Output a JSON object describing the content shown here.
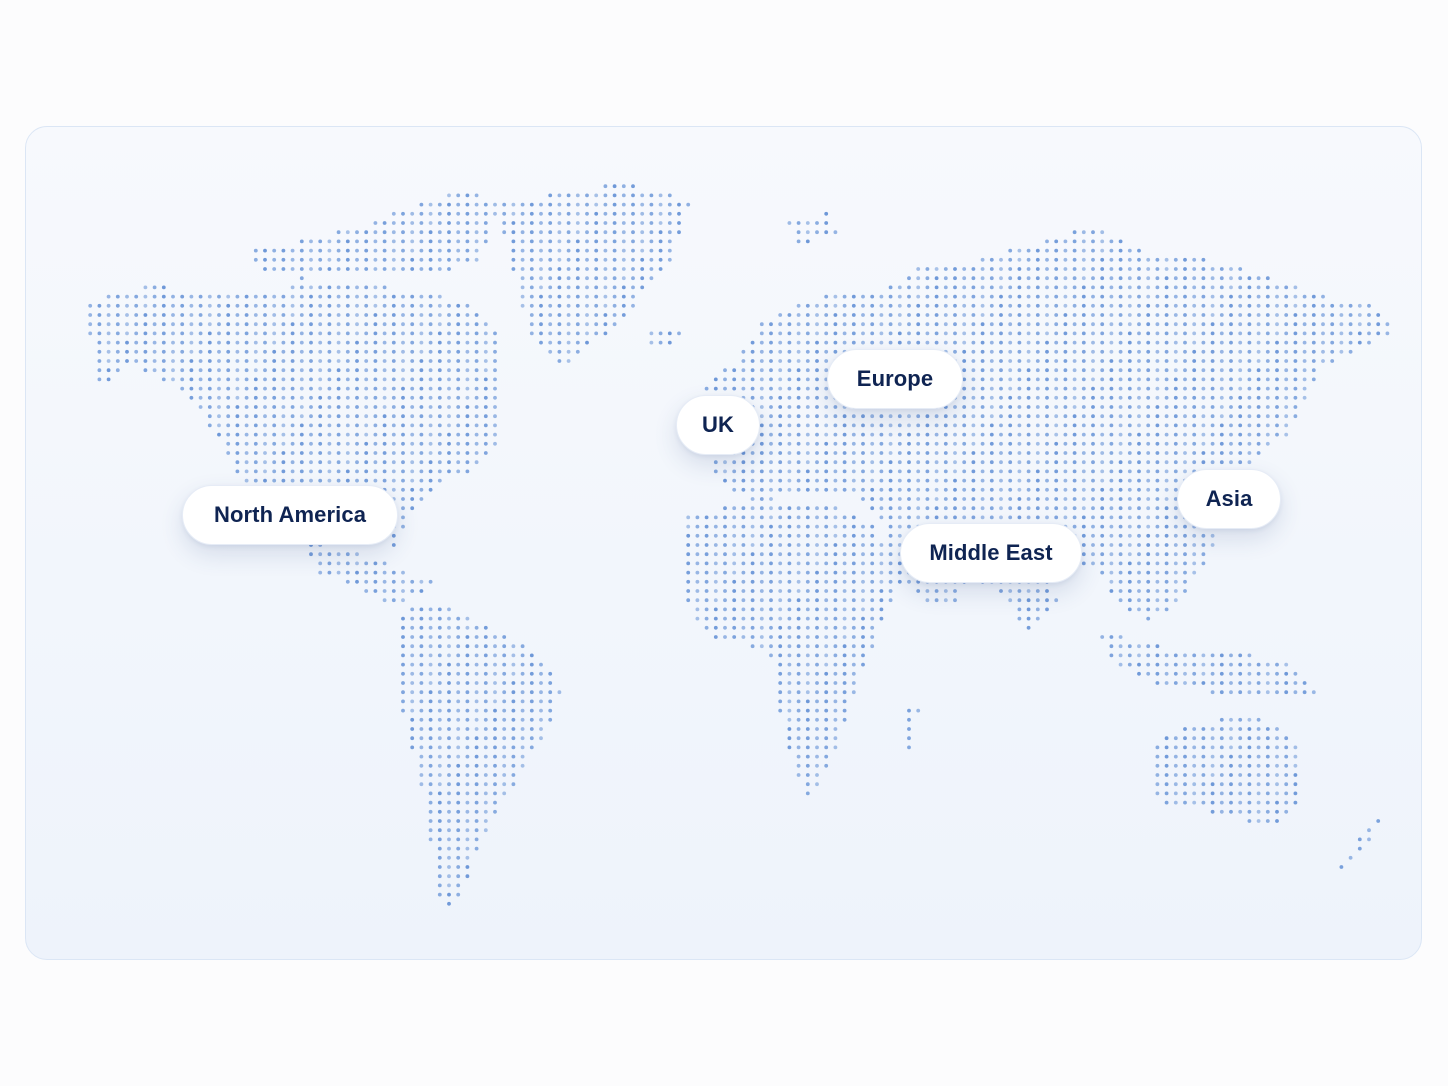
{
  "colors": {
    "dot": "#6c97d8",
    "label_text": "#0f2452",
    "card_border": "#dbe6f5"
  },
  "regions": [
    {
      "id": "north-america",
      "label": "North America"
    },
    {
      "id": "uk",
      "label": "UK"
    },
    {
      "id": "europe",
      "label": "Europe"
    },
    {
      "id": "middle-east",
      "label": "Middle East"
    },
    {
      "id": "asia",
      "label": "Asia"
    }
  ]
}
